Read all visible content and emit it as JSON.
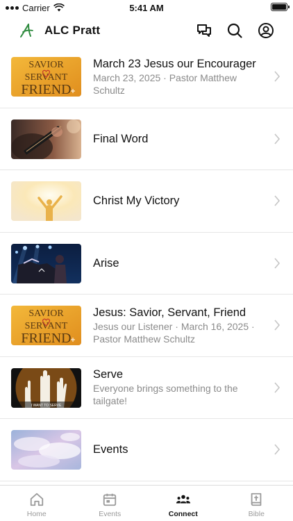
{
  "status": {
    "carrier": "Carrier",
    "time": "5:41 AM"
  },
  "header": {
    "title": "ALC Pratt",
    "logo_icon": "alc-leaf-logo",
    "accent": "#2e8a3e"
  },
  "items": [
    {
      "title": "March 23 Jesus our Encourager",
      "subtitle": "March 23, 2025 · Pastor Matthew Schultz",
      "thumb": "savior-servant-friend",
      "thumb_text": [
        "SAVIOR",
        "SERVANT",
        "FRIEND"
      ]
    },
    {
      "title": "Final Word",
      "subtitle": "",
      "thumb": "guitar-photo"
    },
    {
      "title": "Christ My Victory",
      "subtitle": "",
      "thumb": "raised-arms-light"
    },
    {
      "title": "Arise",
      "subtitle": "",
      "thumb": "worship-concert"
    },
    {
      "title": "Jesus: Savior, Servant, Friend",
      "subtitle": "Jesus our Listener · March 16, 2025 · Pastor Matthew Schultz",
      "thumb": "savior-servant-friend",
      "thumb_text": [
        "SAVIOR",
        "SERVANT",
        "FRIEND"
      ]
    },
    {
      "title": "Serve",
      "subtitle": "Everyone brings something to the tailgate!",
      "thumb": "serve-hands",
      "thumb_text": [
        "I WANT TO SERVE"
      ]
    },
    {
      "title": "Events",
      "subtitle": "",
      "thumb": "sky-clouds"
    }
  ],
  "tabs": [
    {
      "label": "Home",
      "icon": "home-icon",
      "active": false
    },
    {
      "label": "Events",
      "icon": "calendar-icon",
      "active": false
    },
    {
      "label": "Connect",
      "icon": "people-icon",
      "active": true
    },
    {
      "label": "Bible",
      "icon": "bible-icon",
      "active": false
    }
  ]
}
